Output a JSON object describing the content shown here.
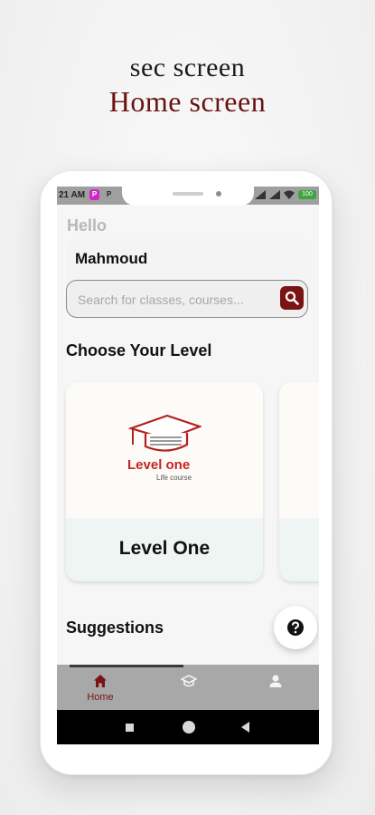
{
  "promo": {
    "line1": "sec screen",
    "line2": "Home screen"
  },
  "statusbar": {
    "time": "21 AM",
    "badge1": "P",
    "badge2": "P",
    "battery": "100"
  },
  "header": {
    "greeting": "Hello",
    "username": "Mahmoud"
  },
  "search": {
    "placeholder": "Search for classes, courses..."
  },
  "levels": {
    "title": "Choose Your Level",
    "cards": [
      {
        "name": "Level One",
        "logo_text": "Level one",
        "logo_subtext": "Life course"
      }
    ]
  },
  "suggestions": {
    "title": "Suggestions"
  },
  "bottom_nav": {
    "items": [
      {
        "label": "Home",
        "icon": "home-icon",
        "active": true
      },
      {
        "label": "",
        "icon": "graduation-cap-icon",
        "active": false
      },
      {
        "label": "",
        "icon": "person-icon",
        "active": false
      }
    ]
  },
  "colors": {
    "accent": "#7a1313",
    "logo_red": "#c72222",
    "card_bottom": "#eef5f2",
    "nav_bg": "#a8a8a8"
  }
}
